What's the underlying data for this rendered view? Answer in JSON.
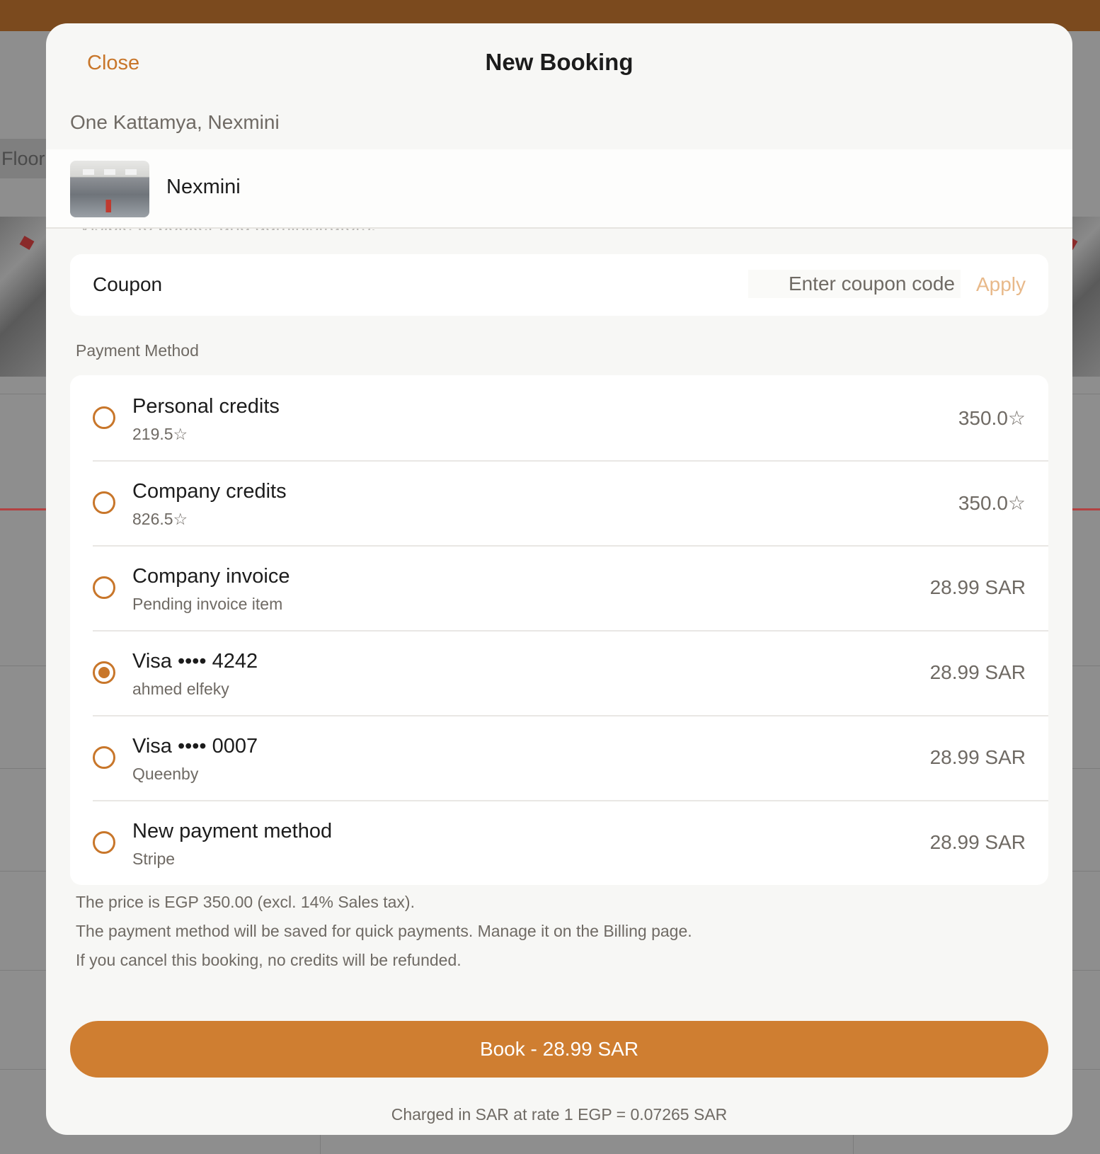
{
  "background": {
    "floor_tab": "Floor"
  },
  "modal": {
    "close_label": "Close",
    "title": "New Booking",
    "location": "One Kattamya, Nexmini",
    "space_name": "Nexmini",
    "faded_text": "Visible to booker and administrators."
  },
  "coupon": {
    "label": "Coupon",
    "placeholder": "Enter coupon code",
    "apply_label": "Apply"
  },
  "payment": {
    "section_label": "Payment Method",
    "methods": [
      {
        "title": "Personal credits",
        "subtitle": "219.5☆",
        "price": "350.0☆",
        "selected": false
      },
      {
        "title": "Company credits",
        "subtitle": "826.5☆",
        "price": "350.0☆",
        "selected": false
      },
      {
        "title": "Company invoice",
        "subtitle": "Pending invoice item",
        "price": "28.99 SAR",
        "selected": false
      },
      {
        "title": "Visa •••• 4242",
        "subtitle": "ahmed elfeky",
        "price": "28.99 SAR",
        "selected": true
      },
      {
        "title": "Visa •••• 0007",
        "subtitle": "Queenby",
        "price": "28.99 SAR",
        "selected": false
      },
      {
        "title": "New payment method",
        "subtitle": "Stripe",
        "price": "28.99 SAR",
        "selected": false
      }
    ]
  },
  "notes": [
    "The price is EGP 350.00 (excl. 14% Sales tax).",
    "The payment method will be saved for quick payments. Manage it on the Billing page.",
    "If you cancel this booking, no credits will be refunded."
  ],
  "book_button_label": "Book - 28.99 SAR",
  "rate_note": "Charged in SAR at rate 1 EGP = 0.07265 SAR",
  "colors": {
    "accent": "#cf7e31",
    "accent_text": "#c8762a",
    "apply_disabled": "#e8b98a",
    "topbar": "#7b4a1e"
  }
}
